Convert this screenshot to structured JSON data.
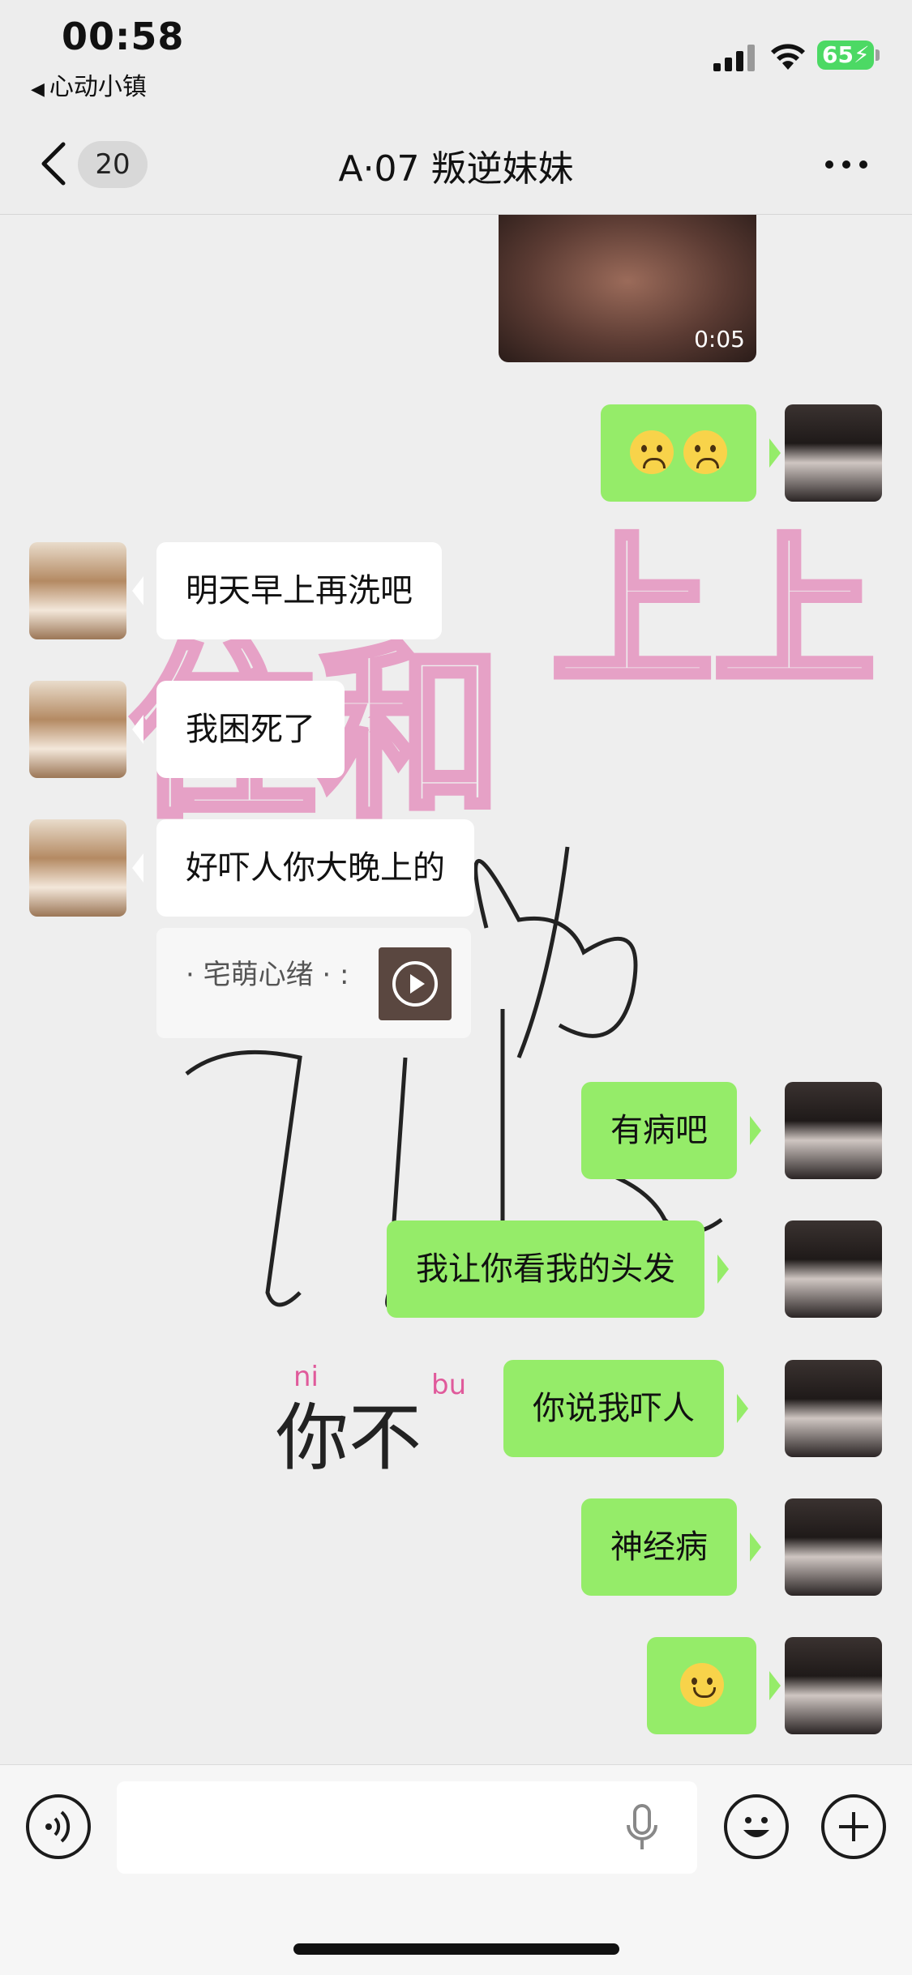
{
  "status_bar": {
    "time": "00:58",
    "back_app": "心动小镇",
    "battery": "65"
  },
  "header": {
    "unread_count": "20",
    "title": "A·07 叛逆妹妹"
  },
  "video": {
    "duration": "0:05"
  },
  "messages": {
    "m1": "明天早上再洗吧",
    "m2": "我困死了",
    "m3": "好吓人你大晚上的",
    "share": "· 宅萌心绪 · :",
    "m4": "有病吧",
    "m5": "我让你看我的头发",
    "m6": "你说我吓人",
    "m7": "神经病"
  },
  "background_art": {
    "big_text_1": "住和",
    "big_text_2": "上上",
    "handwriting": "你不",
    "pinyin_1": "ni",
    "pinyin_2": "bu"
  },
  "colors": {
    "outgoing_bubble": "#95ec69",
    "incoming_bubble": "#ffffff",
    "background": "#ededed"
  },
  "icons": [
    "back-chevron-icon",
    "more-icon",
    "voice-icon",
    "mic-icon",
    "emoji-icon",
    "plus-icon"
  ]
}
